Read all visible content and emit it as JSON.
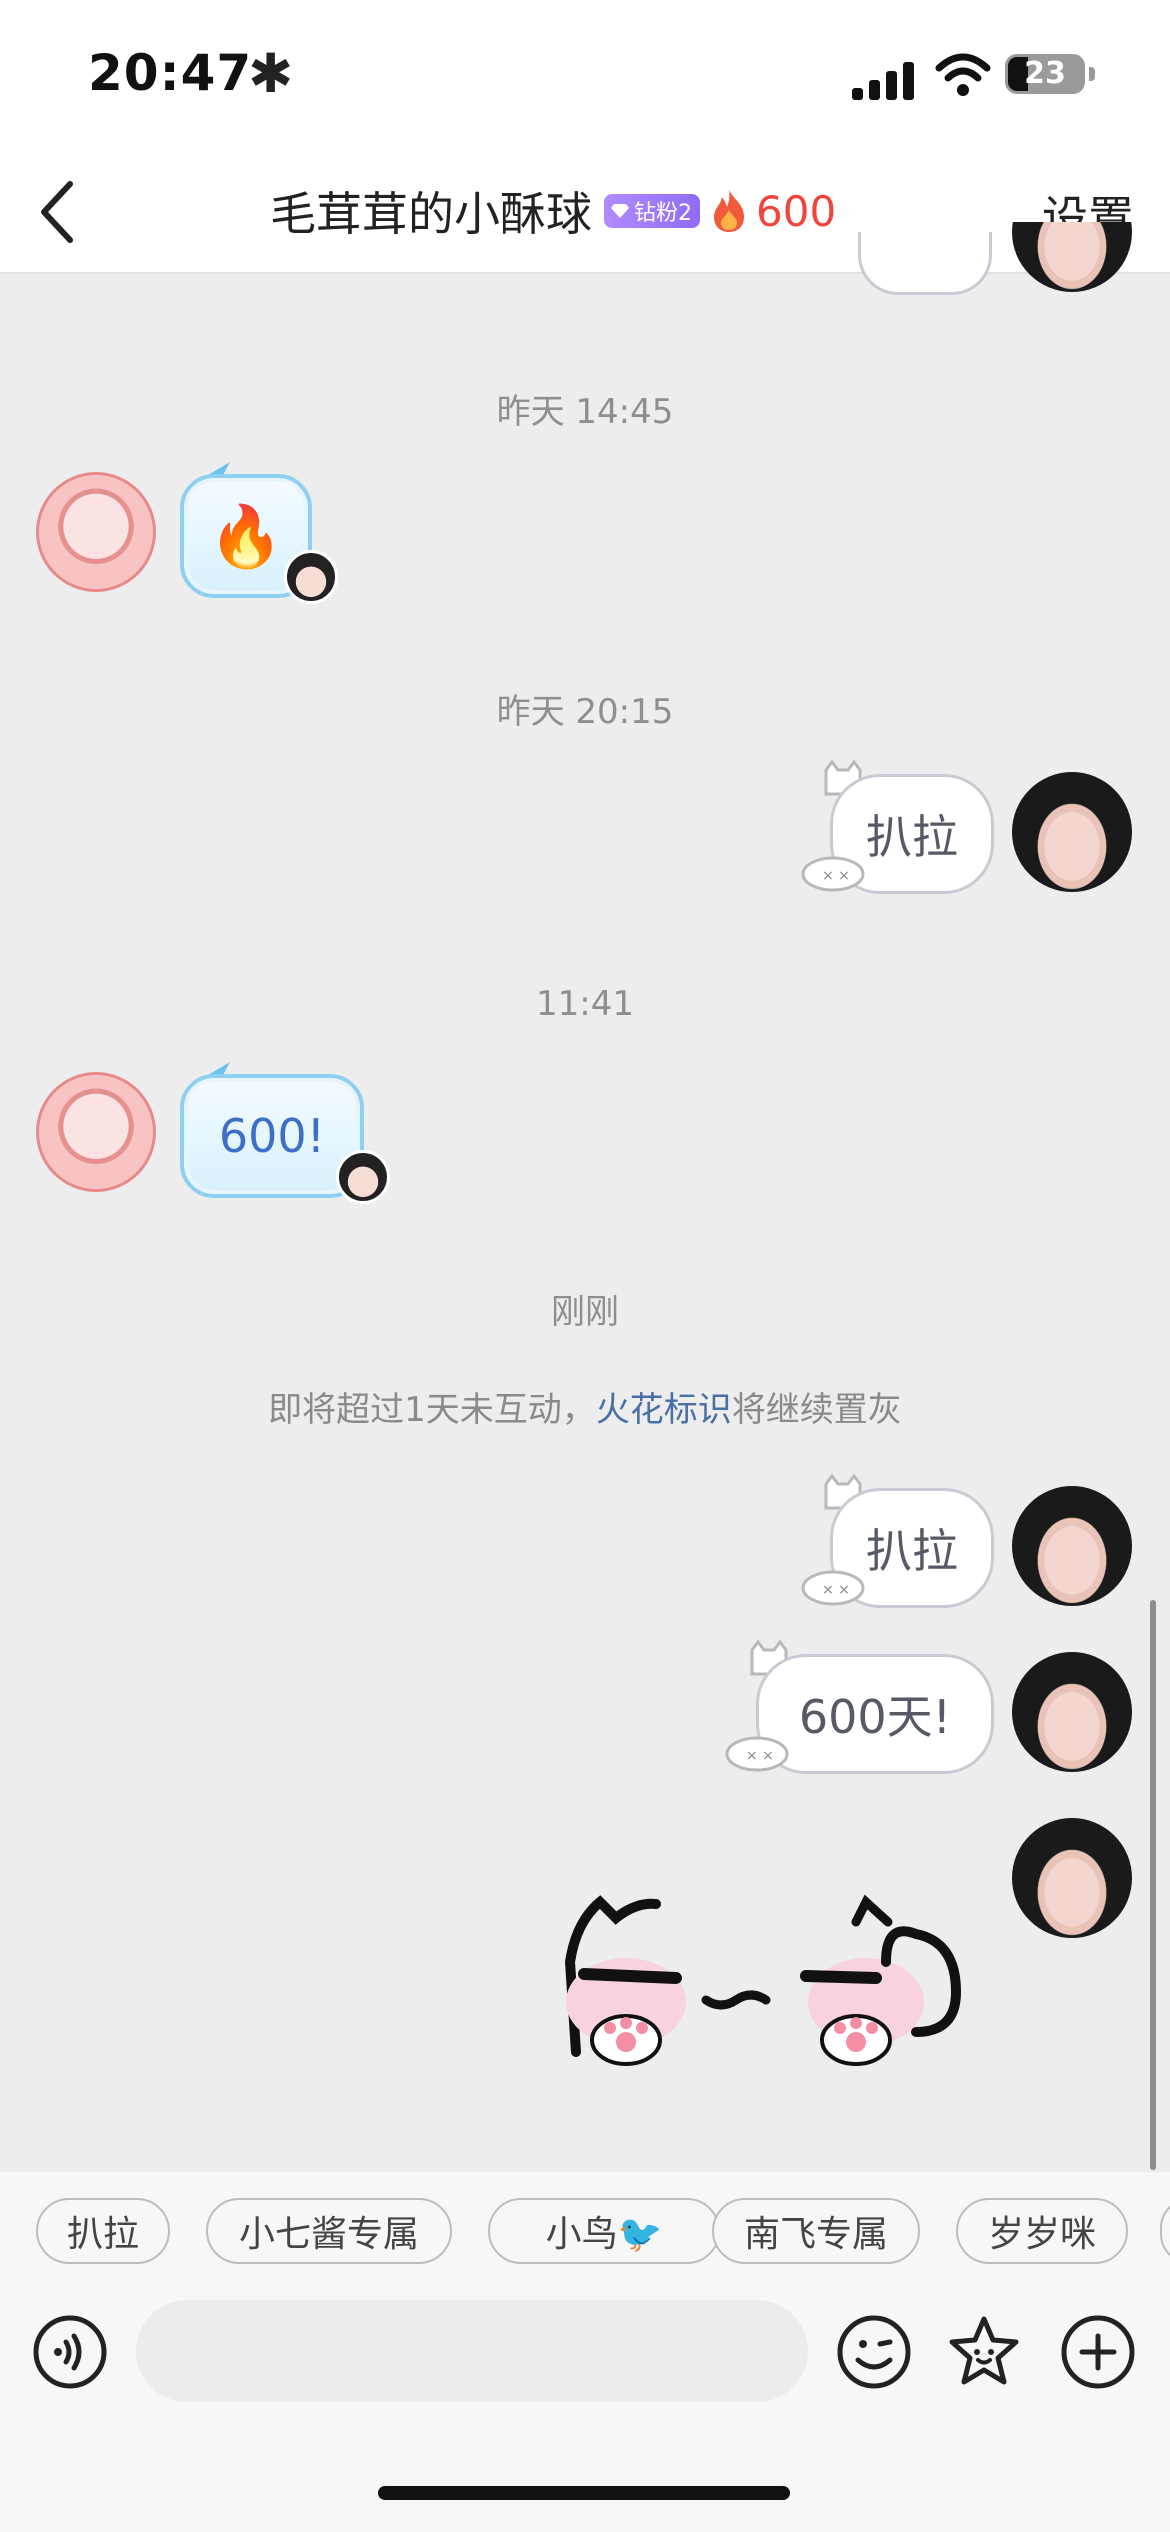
{
  "status_bar": {
    "time": "20:47",
    "battery": "23"
  },
  "header": {
    "title": "毛茸茸的小酥球",
    "badge": "钻粉2",
    "fire_count": "600",
    "settings": "设置"
  },
  "messages": {
    "ts1": "昨天 14:45",
    "ts2": "昨天 20:15",
    "ts3": "11:41",
    "ts4": "刚刚",
    "msg_fire_emoji": "🔥",
    "msg_pala_1": "扒拉",
    "msg_600": "600!",
    "msg_pala_2": "扒拉",
    "msg_600_days": "600天!",
    "system_prefix": "即将超过1天未互动，",
    "system_link": "火花标识",
    "system_suffix": "将继续置灰"
  },
  "quick_replies": [
    "扒拉",
    "小七酱专属",
    "小鸟🐦",
    "南飞专属",
    "岁岁咪"
  ],
  "colors": {
    "fire_red": "#f0443c",
    "link_blue": "#4a6fa5",
    "bubble_left_border": "#8fd0f2"
  },
  "icons": [
    "back-chevron-icon",
    "diamond-icon",
    "fire-icon",
    "voice-icon",
    "emoji-icon",
    "sticker-icon",
    "plus-icon"
  ]
}
